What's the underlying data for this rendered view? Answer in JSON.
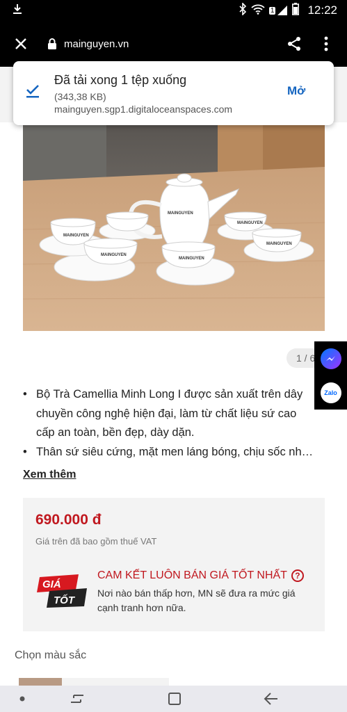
{
  "status_bar": {
    "time": "12:22",
    "battery_icon": "battery-icon",
    "sim_badge": "1"
  },
  "browser": {
    "domain": "mainguyen.vn"
  },
  "download_notification": {
    "title": "Đã tải xong 1 tệp xuống",
    "size": "(343,38 KB)",
    "source": "mainguyen.sgp1.digitaloceanspaces.com",
    "open_label": "Mở"
  },
  "product_image": {
    "cup_brand": "MAINGUYEN",
    "counter": "1 / 6"
  },
  "description": {
    "bullets": [
      "Bộ Trà Camellia Minh Long I được sản xuất trên dây chuyền công nghệ hiện đại, làm từ chất liệu sứ cao cấp an toàn, bền đẹp, dày dặn.",
      "Thân sứ siêu cứng, mặt men láng bóng, chịu sốc nhiệt tốt."
    ],
    "more_label": "Xem thêm"
  },
  "pricing": {
    "price": "690.000 đ",
    "vat_note": "Giá trên đã bao gồm thuế VAT",
    "badge_line1": "GIÁ",
    "badge_line2": "TỐT",
    "promise_title": "CAM KẾT LUÔN BÁN GIÁ TỐT NHẤT",
    "help_glyph": "?",
    "promise_desc": "Nơi nào bán thấp hơn, MN sẽ đưa ra mức giá cạnh tranh hơn nữa."
  },
  "colors": {
    "title": "Chọn màu sắc"
  },
  "floating_contacts": {
    "zalo_label": "Zalo"
  },
  "theme": {
    "accent_red": "#c0181f",
    "link_blue": "#1565c0"
  }
}
